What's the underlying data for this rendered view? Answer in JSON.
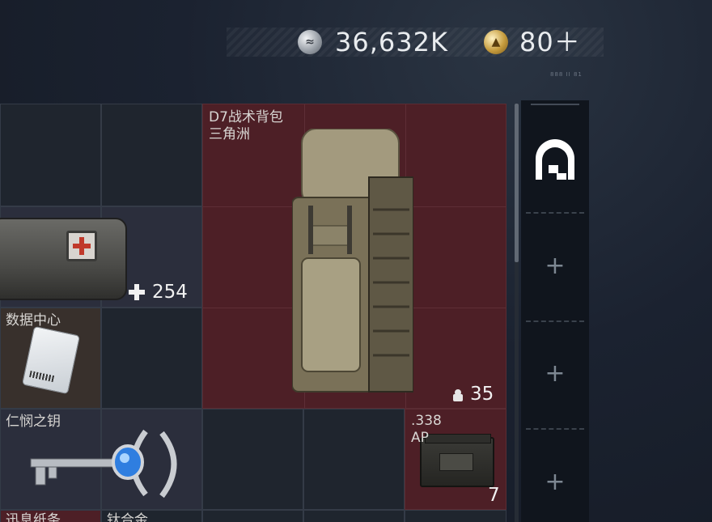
{
  "currency": {
    "silver_icon": "silver-coin-icon",
    "silver_amount": "36,632K",
    "gold_icon": "gold-coin-icon",
    "gold_amount": "80＋"
  },
  "small_caption": "888 II 81",
  "inventory": {
    "backpack": {
      "name": "D7战术背包",
      "subtitle": "三角洲",
      "weight": "35",
      "weight_icon": "weight-icon"
    },
    "medkit": {
      "count": "254",
      "count_icon": "plus-icon"
    },
    "data_card": {
      "name": "数据中心"
    },
    "key": {
      "name": "仁悯之钥"
    },
    "ammo": {
      "name_line1": ".338",
      "name_line2": "AP",
      "count": "7"
    },
    "bottom_left": {
      "name": "迅息纸条"
    },
    "bottom_mid": {
      "name": "钛合金"
    }
  },
  "sidebar": {
    "equipped_icon": "arch-slot-icon",
    "add_slots": [
      "+",
      "+",
      "+"
    ]
  },
  "colors": {
    "rare_red": "#4d1f26",
    "epic_blue": "#2b2e3c",
    "common": "#1f252e"
  }
}
